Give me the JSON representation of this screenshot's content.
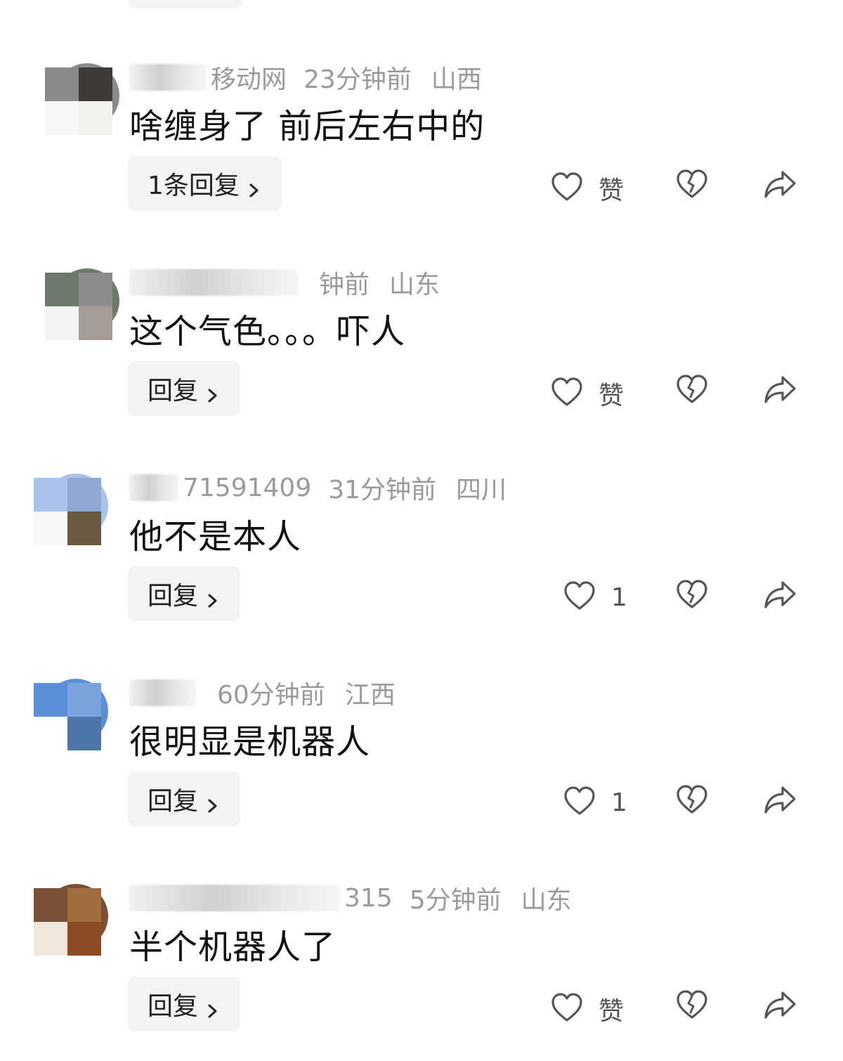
{
  "comments": [
    {
      "username": "移动网",
      "time": "23分钟前",
      "location": "山西",
      "text": "啥缠身了 前后左右中的",
      "reply_label": "1条回复",
      "like_label": "赞",
      "avatar_colors": [
        "#8a8a8a",
        "#3f3a36",
        "#f6f6f6",
        "#f3f1ee"
      ]
    },
    {
      "username": "",
      "time": "钟前",
      "location": "山东",
      "text": "这个气色。。。吓人",
      "reply_label": "回复",
      "like_label": "赞",
      "avatar_colors": [
        "#6e7a6a",
        "#8c8c8c",
        "#f4f4f4",
        "#a79c94"
      ]
    },
    {
      "username": "71591409",
      "time": "31分钟前",
      "location": "四川",
      "text": "他不是本人",
      "reply_label": "回复",
      "like_label": "1",
      "avatar_colors": [
        "#a9c3ea",
        "#8fa8d4",
        "#f7f7f7",
        "#6d5a44"
      ]
    },
    {
      "username": "",
      "time": "60分钟前",
      "location": "江西",
      "text": "很明显是机器人",
      "reply_label": "回复",
      "like_label": "1",
      "avatar_colors": [
        "#5b8fd6",
        "#78a3dc",
        "#ffffff",
        "#4f76a8"
      ]
    },
    {
      "username": "315",
      "time": "5分钟前",
      "location": "山东",
      "text": "半个机器人了",
      "reply_label": "回复",
      "like_label": "赞",
      "avatar_colors": [
        "#7a5036",
        "#a36c3f",
        "#f1e7dc",
        "#8c4a22"
      ]
    }
  ],
  "icons": {
    "like": "heart-outline-icon",
    "dislike": "broken-heart-icon",
    "share": "share-arrow-icon",
    "chevron": "chevron-right-icon"
  }
}
